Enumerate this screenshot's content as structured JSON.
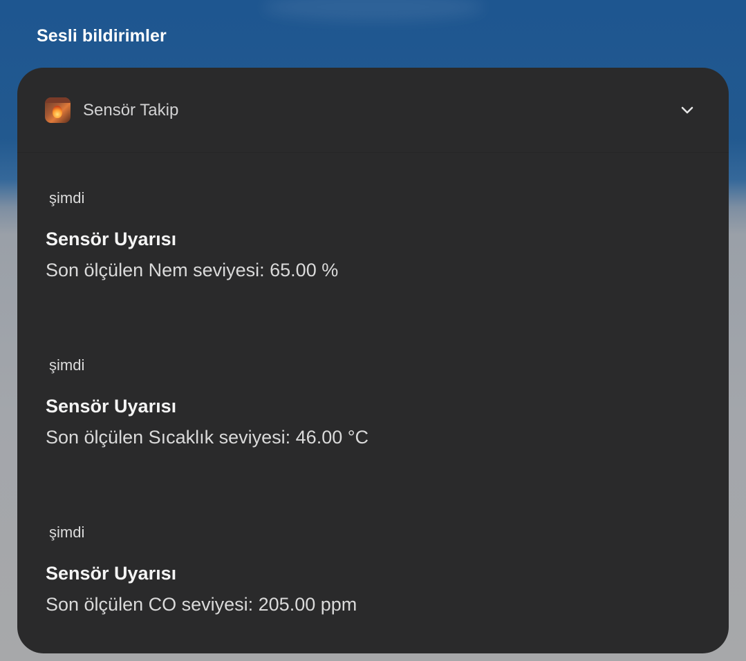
{
  "section": {
    "title": "Sesli bildirimler"
  },
  "app": {
    "name": "Sensör Takip",
    "icon": "fireplace-app-icon"
  },
  "expand_icon": "chevron-down-icon",
  "notifications": [
    {
      "time": "şimdi",
      "title": "Sensör Uyarısı",
      "body": "Son ölçülen Nem seviyesi: 65.00 %"
    },
    {
      "time": "şimdi",
      "title": "Sensör Uyarısı",
      "body": "Son ölçülen Sıcaklık seviyesi: 46.00 °C"
    },
    {
      "time": "şimdi",
      "title": "Sensör Uyarısı",
      "body": "Son ölçülen CO seviyesi: 205.00 ppm"
    }
  ],
  "colors": {
    "card_background": "#2a2a2b",
    "wallpaper_top": "#1e5690",
    "wallpaper_bottom": "#a7a8aa"
  }
}
